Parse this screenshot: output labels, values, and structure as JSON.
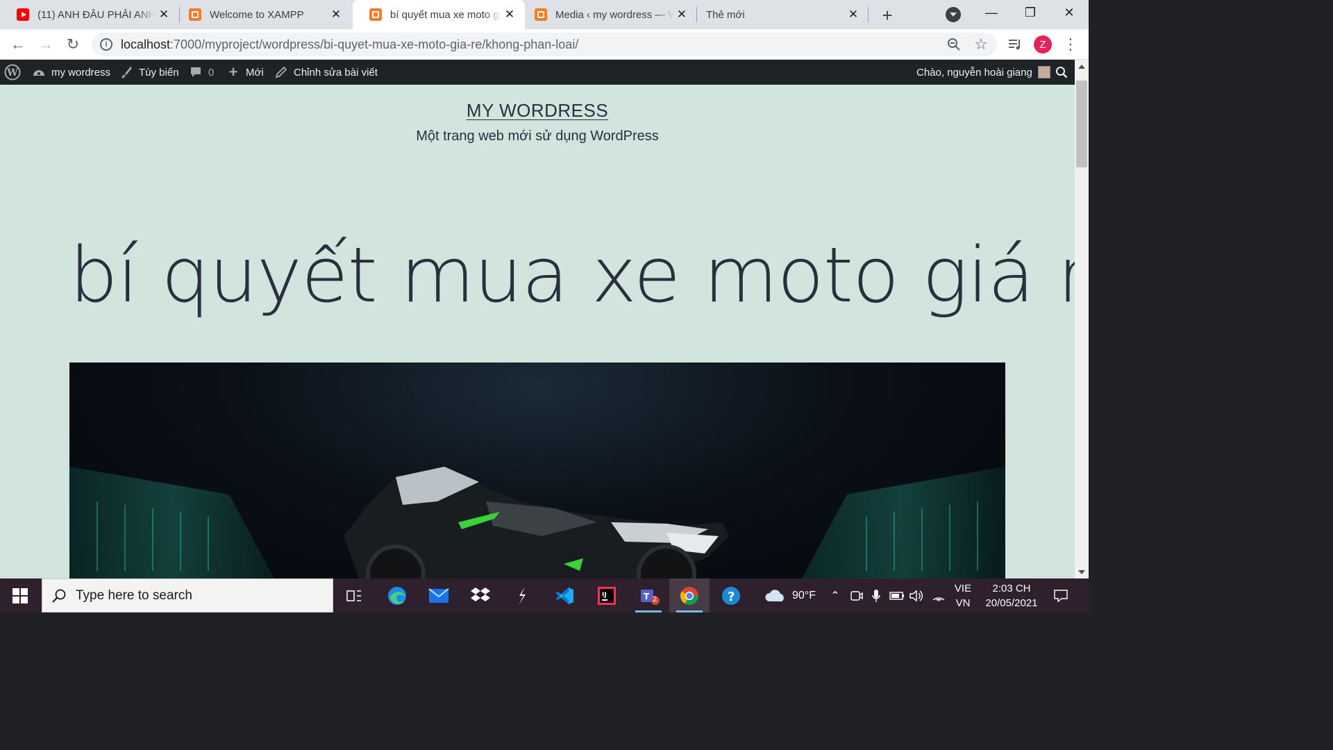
{
  "browser": {
    "tabs": [
      {
        "title": "(11) ANH ĐÂU PHẢI ANH",
        "favicon": "youtube-icon",
        "active": false
      },
      {
        "title": "Welcome to XAMPP",
        "favicon": "xampp-icon",
        "active": false
      },
      {
        "title": "bí quyết mua xe moto giá rẻ",
        "favicon": "xampp-icon",
        "active": true
      },
      {
        "title": "Media ‹ my wordress — WordPress",
        "favicon": "xampp-icon",
        "active": false
      },
      {
        "title": "Thẻ mới",
        "favicon": "",
        "active": false
      }
    ],
    "url_host": "localhost",
    "url_rest": ":7000/myproject/wordpress/bi-quyet-mua-xe-moto-gia-re/khong-phan-loai/",
    "profile_initial": "Z",
    "profile_color": "#e3245c"
  },
  "adminbar": {
    "site_name": "my wordress",
    "customize": "Tùy biến",
    "comments_count": "0",
    "new_label": "Mới",
    "edit_label": "Chỉnh sửa bài viết",
    "greeting": "Chào, nguyễn hoài giang"
  },
  "page": {
    "site_title": "MY WORDRESS",
    "site_description": "Một trang web mới sử dụng WordPress",
    "post_title": "bí quyết mua xe moto giá rẻ",
    "background_color": "#d1e4dd",
    "text_color": "#28303d"
  },
  "taskbar": {
    "search_placeholder": "Type here to search",
    "weather_temp": "90°F",
    "lang_line1": "VIE",
    "lang_line2": "VN",
    "time": "2:03 CH",
    "date": "20/05/2021",
    "teams_badge": "2"
  }
}
